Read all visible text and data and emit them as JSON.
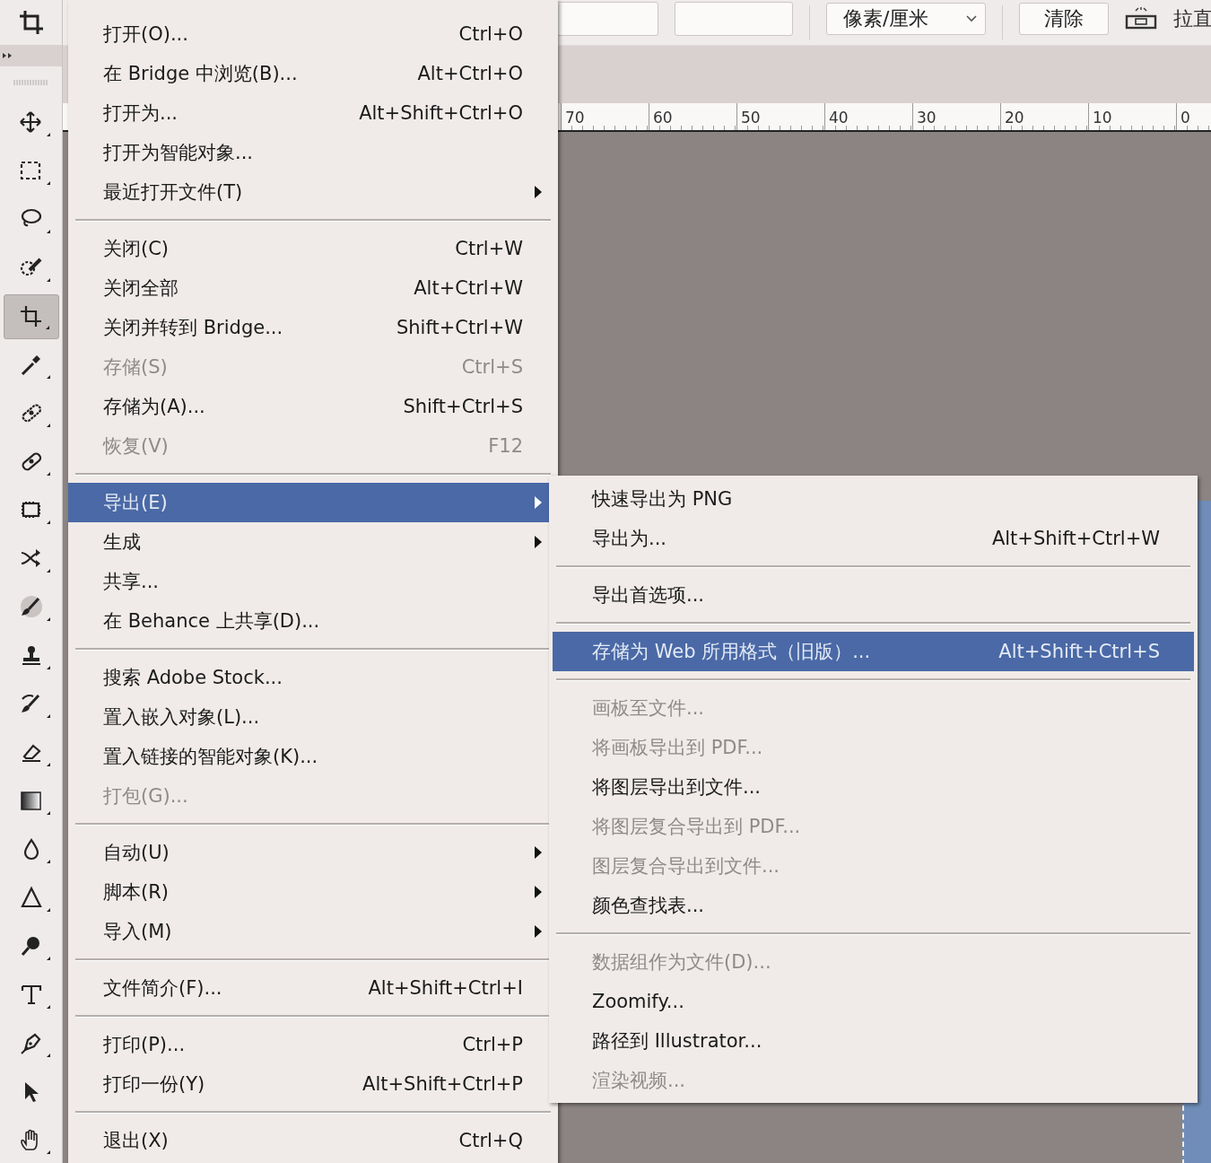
{
  "toolbar": {
    "tools": [
      {
        "selected": false
      },
      {
        "selected": false
      },
      {
        "selected": false
      },
      {
        "selected": false
      },
      {
        "selected": true
      },
      {
        "selected": false
      },
      {
        "selected": false
      },
      {
        "selected": false
      },
      {
        "selected": false
      },
      {
        "selected": false
      },
      {
        "selected": false
      },
      {
        "selected": false
      },
      {
        "selected": false
      },
      {
        "selected": false
      },
      {
        "selected": false
      },
      {
        "selected": false
      },
      {
        "selected": false
      },
      {
        "selected": false
      },
      {
        "selected": false
      },
      {
        "selected": false
      },
      {
        "selected": false
      },
      {
        "selected": false
      }
    ]
  },
  "options_bar": {
    "unit_dropdown": {
      "value": "像素/厘米"
    },
    "clear_button": "清除",
    "straighten_label": "拉直"
  },
  "ruler": {
    "labels": [
      "70",
      "60",
      "50",
      "40",
      "30",
      "20",
      "10",
      "0"
    ]
  },
  "file_menu": {
    "items": [
      {
        "kind": "item",
        "label": "打开(O)...",
        "shortcut": "Ctrl+O",
        "has_submenu": false,
        "disabled": false,
        "selected": false
      },
      {
        "kind": "item",
        "label": "在 Bridge 中浏览(B)...",
        "shortcut": "Alt+Ctrl+O",
        "has_submenu": false,
        "disabled": false,
        "selected": false
      },
      {
        "kind": "item",
        "label": "打开为...",
        "shortcut": "Alt+Shift+Ctrl+O",
        "has_submenu": false,
        "disabled": false,
        "selected": false
      },
      {
        "kind": "item",
        "label": "打开为智能对象...",
        "has_submenu": false,
        "disabled": false,
        "selected": false
      },
      {
        "kind": "item",
        "label": "最近打开文件(T)",
        "has_submenu": true,
        "disabled": false,
        "selected": false
      },
      {
        "kind": "separator"
      },
      {
        "kind": "item",
        "label": "关闭(C)",
        "shortcut": "Ctrl+W",
        "has_submenu": false,
        "disabled": false,
        "selected": false
      },
      {
        "kind": "item",
        "label": "关闭全部",
        "shortcut": "Alt+Ctrl+W",
        "has_submenu": false,
        "disabled": false,
        "selected": false
      },
      {
        "kind": "item",
        "label": "关闭并转到 Bridge...",
        "shortcut": "Shift+Ctrl+W",
        "has_submenu": false,
        "disabled": false,
        "selected": false
      },
      {
        "kind": "item",
        "label": "存储(S)",
        "shortcut": "Ctrl+S",
        "has_submenu": false,
        "disabled": true,
        "selected": false
      },
      {
        "kind": "item",
        "label": "存储为(A)...",
        "shortcut": "Shift+Ctrl+S",
        "has_submenu": false,
        "disabled": false,
        "selected": false
      },
      {
        "kind": "item",
        "label": "恢复(V)",
        "shortcut": "F12",
        "has_submenu": false,
        "disabled": true,
        "selected": false
      },
      {
        "kind": "separator"
      },
      {
        "kind": "item",
        "label": "导出(E)",
        "has_submenu": true,
        "disabled": false,
        "selected": true
      },
      {
        "kind": "item",
        "label": "生成",
        "has_submenu": true,
        "disabled": false,
        "selected": false
      },
      {
        "kind": "item",
        "label": "共享...",
        "has_submenu": false,
        "disabled": false,
        "selected": false
      },
      {
        "kind": "item",
        "label": "在 Behance 上共享(D)...",
        "has_submenu": false,
        "disabled": false,
        "selected": false
      },
      {
        "kind": "separator"
      },
      {
        "kind": "item",
        "label": "搜索 Adobe Stock...",
        "has_submenu": false,
        "disabled": false,
        "selected": false
      },
      {
        "kind": "item",
        "label": "置入嵌入对象(L)...",
        "has_submenu": false,
        "disabled": false,
        "selected": false
      },
      {
        "kind": "item",
        "label": "置入链接的智能对象(K)...",
        "has_submenu": false,
        "disabled": false,
        "selected": false
      },
      {
        "kind": "item",
        "label": "打包(G)...",
        "has_submenu": false,
        "disabled": true,
        "selected": false
      },
      {
        "kind": "separator"
      },
      {
        "kind": "item",
        "label": "自动(U)",
        "has_submenu": true,
        "disabled": false,
        "selected": false
      },
      {
        "kind": "item",
        "label": "脚本(R)",
        "has_submenu": true,
        "disabled": false,
        "selected": false
      },
      {
        "kind": "item",
        "label": "导入(M)",
        "has_submenu": true,
        "disabled": false,
        "selected": false
      },
      {
        "kind": "separator"
      },
      {
        "kind": "item",
        "label": "文件简介(F)...",
        "shortcut": "Alt+Shift+Ctrl+I",
        "has_submenu": false,
        "disabled": false,
        "selected": false
      },
      {
        "kind": "separator"
      },
      {
        "kind": "item",
        "label": "打印(P)...",
        "shortcut": "Ctrl+P",
        "has_submenu": false,
        "disabled": false,
        "selected": false
      },
      {
        "kind": "item",
        "label": "打印一份(Y)",
        "shortcut": "Alt+Shift+Ctrl+P",
        "has_submenu": false,
        "disabled": false,
        "selected": false
      },
      {
        "kind": "separator"
      },
      {
        "kind": "item",
        "label": "退出(X)",
        "shortcut": "Ctrl+Q",
        "has_submenu": false,
        "disabled": false,
        "selected": false
      }
    ]
  },
  "export_submenu": {
    "items": [
      {
        "kind": "item",
        "label": "快速导出为 PNG",
        "disabled": false,
        "selected": false
      },
      {
        "kind": "item",
        "label": "导出为...",
        "shortcut": "Alt+Shift+Ctrl+W",
        "disabled": false,
        "selected": false
      },
      {
        "kind": "separator"
      },
      {
        "kind": "item",
        "label": "导出首选项...",
        "disabled": false,
        "selected": false
      },
      {
        "kind": "separator"
      },
      {
        "kind": "item",
        "label": "存储为 Web 所用格式（旧版）...",
        "shortcut": "Alt+Shift+Ctrl+S",
        "disabled": false,
        "selected": true
      },
      {
        "kind": "separator"
      },
      {
        "kind": "item",
        "label": "画板至文件...",
        "disabled": true,
        "selected": false
      },
      {
        "kind": "item",
        "label": "将画板导出到 PDF...",
        "disabled": true,
        "selected": false
      },
      {
        "kind": "item",
        "label": "将图层导出到文件...",
        "disabled": false,
        "selected": false
      },
      {
        "kind": "item",
        "label": "将图层复合导出到 PDF...",
        "disabled": true,
        "selected": false
      },
      {
        "kind": "item",
        "label": "图层复合导出到文件...",
        "disabled": true,
        "selected": false
      },
      {
        "kind": "item",
        "label": "颜色查找表...",
        "disabled": false,
        "selected": false
      },
      {
        "kind": "separator"
      },
      {
        "kind": "item",
        "label": "数据组作为文件(D)...",
        "disabled": true,
        "selected": false
      },
      {
        "kind": "item",
        "label": "Zoomify...",
        "disabled": false,
        "selected": false
      },
      {
        "kind": "item",
        "label": "路径到 Illustrator...",
        "disabled": false,
        "selected": false
      },
      {
        "kind": "item",
        "label": "渲染视频...",
        "disabled": true,
        "selected": false
      }
    ]
  }
}
